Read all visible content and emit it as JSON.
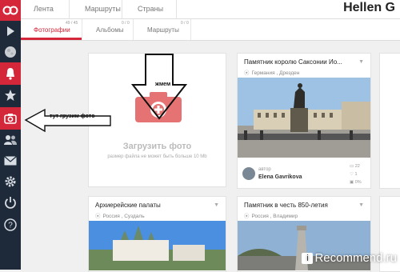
{
  "app": {
    "logo": "oo",
    "user_name": "Hellen G"
  },
  "sidebar": {
    "items": [
      {
        "name": "logo-icon"
      },
      {
        "name": "play-icon"
      },
      {
        "name": "moon-icon"
      },
      {
        "name": "bell-icon"
      },
      {
        "name": "star-icon"
      },
      {
        "name": "camera-icon"
      },
      {
        "name": "users-icon"
      },
      {
        "name": "mail-icon"
      },
      {
        "name": "gear-icon"
      },
      {
        "name": "power-icon"
      },
      {
        "name": "help-icon"
      }
    ]
  },
  "topnav": {
    "tabs": [
      "Лента",
      "Маршруты",
      "Страны"
    ]
  },
  "subnav": {
    "tabs": [
      {
        "label": "Фотографии",
        "count": "49 / 45"
      },
      {
        "label": "Альбомы",
        "count": "0 / 0"
      },
      {
        "label": "Маршруты",
        "count": "0 / 0"
      }
    ]
  },
  "upload": {
    "title": "Загрузить фото",
    "hint": "размер файла не может быть больше 10 Mb"
  },
  "cards": [
    {
      "title": "Памятник королю Саксонии Ио...",
      "location": "Германия , Дрезден",
      "author_label": "автор",
      "author": "Elena Gavrikova",
      "stats": [
        "22",
        "1",
        "0%"
      ]
    },
    {
      "title": "Архиерейские палаты",
      "location": "Россия , Суздаль"
    },
    {
      "title": "Памятник в честь 850-летия",
      "location": "Россия , Владимир"
    }
  ],
  "annotations": {
    "upload_arrow": "тут грузим фото",
    "click_arrow": "жмем"
  },
  "watermark": "Recommend.ru",
  "colors": {
    "accent": "#d4283a",
    "sidebar": "#1e2a3a"
  }
}
